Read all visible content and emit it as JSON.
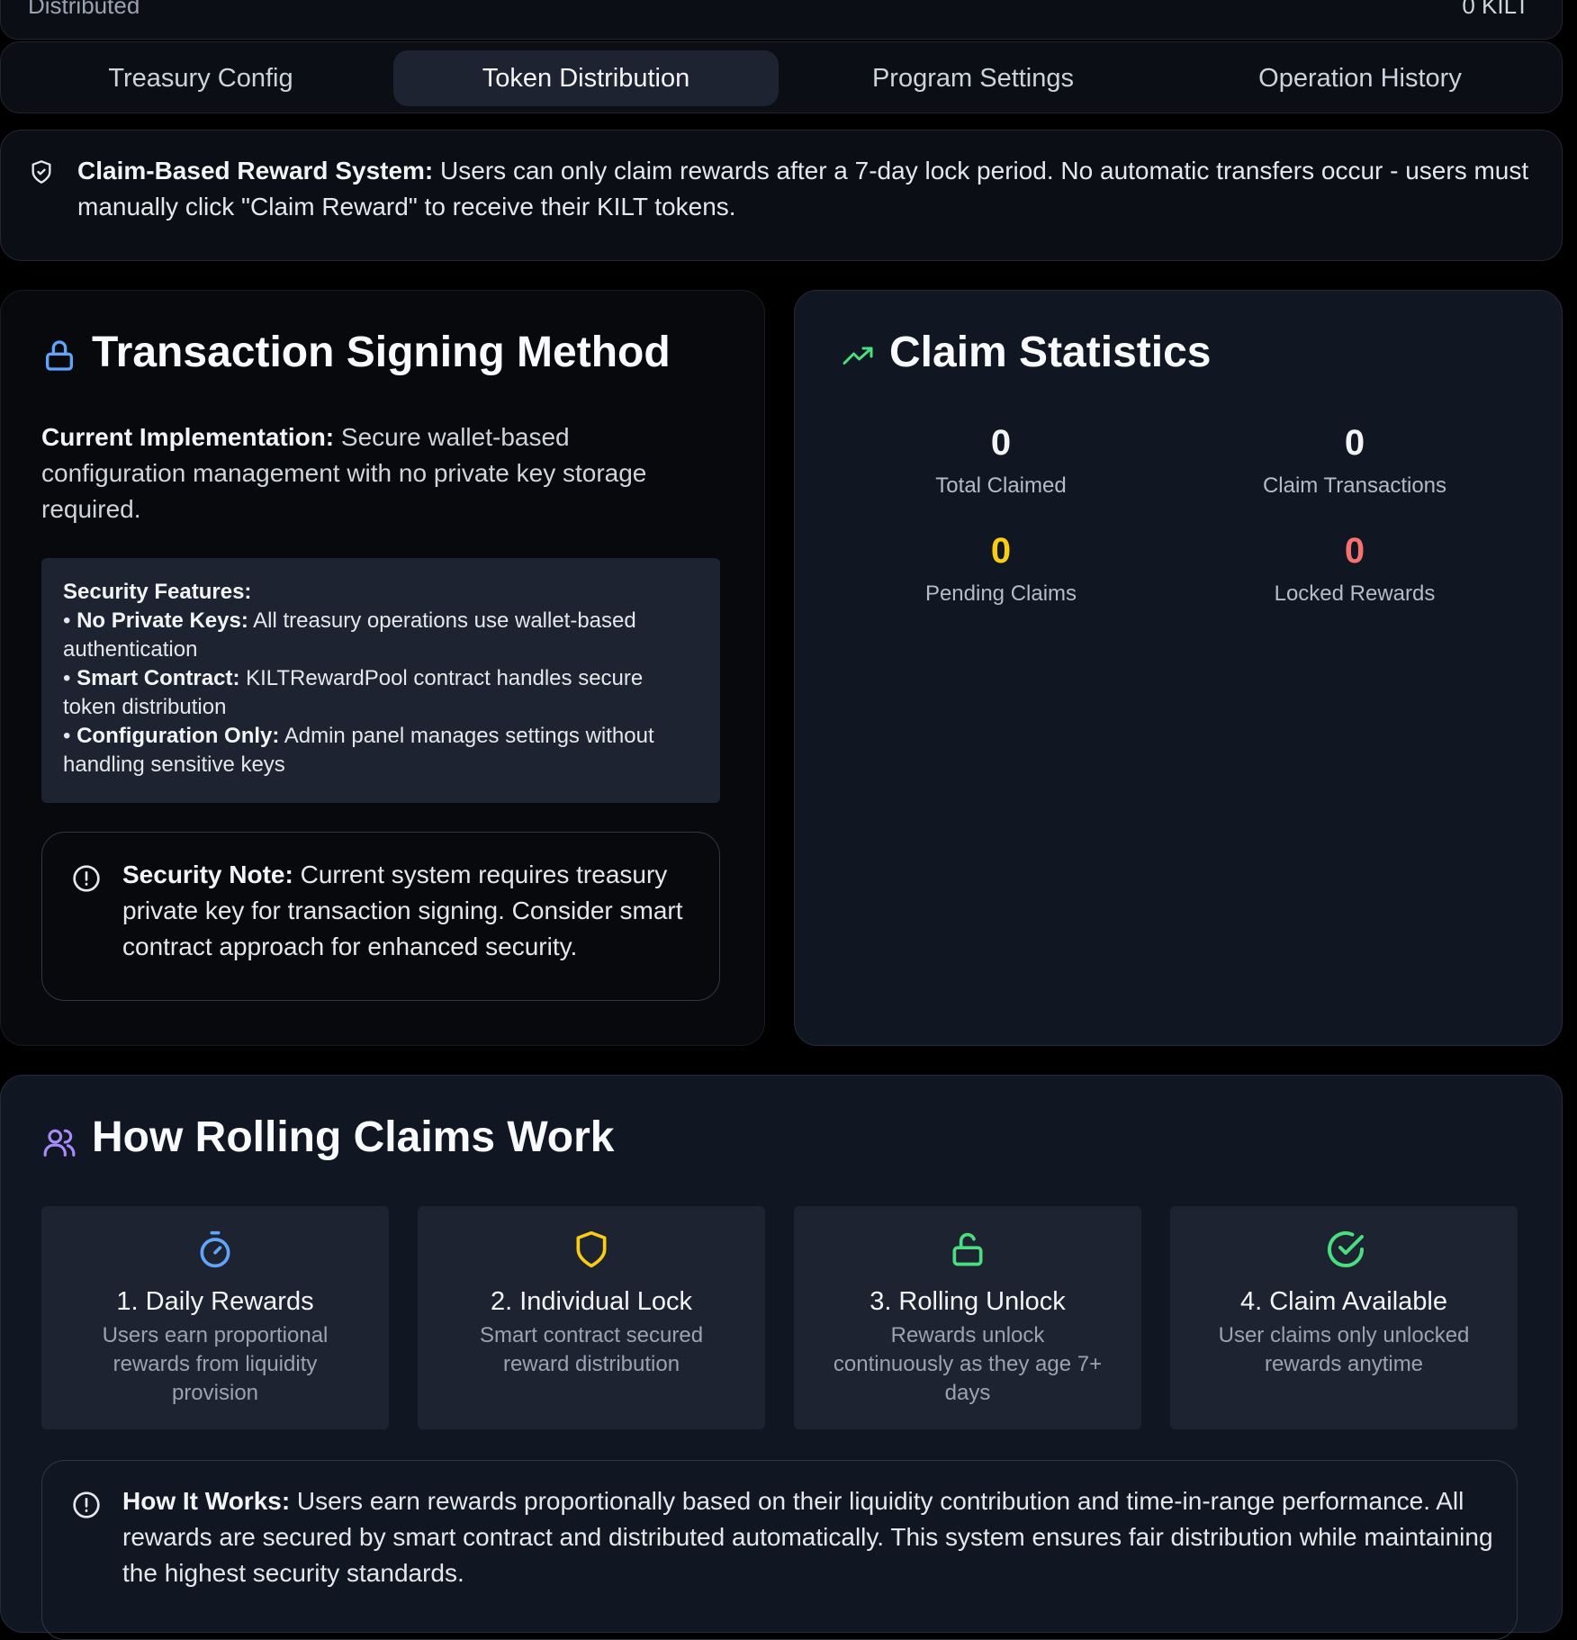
{
  "topbar": {
    "left_label": "Distributed",
    "right_value": "0 KILT"
  },
  "tabs": [
    {
      "label": "Treasury Config",
      "active": false
    },
    {
      "label": "Token Distribution",
      "active": true
    },
    {
      "label": "Program Settings",
      "active": false
    },
    {
      "label": "Operation History",
      "active": false
    }
  ],
  "banner": {
    "bold": "Claim-Based Reward System:",
    "text": " Users can only claim rewards after a 7-day lock period. No automatic transfers occur - users must manually click \"Claim Reward\" to receive their KILT tokens."
  },
  "signing": {
    "title": "Transaction Signing Method",
    "impl_bold": "Current Implementation:",
    "impl_text": " Secure wallet-based configuration management with no private key storage required.",
    "features_title": "Security Features:",
    "features": [
      {
        "bold": "No Private Keys:",
        "text": " All treasury operations use wallet-based authentication"
      },
      {
        "bold": "Smart Contract:",
        "text": " KILTRewardPool contract handles secure token distribution"
      },
      {
        "bold": "Configuration Only:",
        "text": " Admin panel manages settings without handling sensitive keys"
      }
    ],
    "note_bold": "Security Note:",
    "note_text": " Current system requires treasury private key for transaction signing. Consider smart contract approach for enhanced security."
  },
  "claims": {
    "title": "Claim Statistics",
    "stats": [
      {
        "value": "0",
        "label": "Total Claimed",
        "color": "#f3f4f6"
      },
      {
        "value": "0",
        "label": "Claim Transactions",
        "color": "#f3f4f6"
      },
      {
        "value": "0",
        "label": "Pending Claims",
        "color": "#facc15"
      },
      {
        "value": "0",
        "label": "Locked Rewards",
        "color": "#f87171"
      }
    ]
  },
  "rolling": {
    "title": "How Rolling Claims Work",
    "steps": [
      {
        "title": "1. Daily Rewards",
        "desc": "Users earn proportional rewards from liquidity provision",
        "icon": "timer-icon",
        "color": "#60a5fa"
      },
      {
        "title": "2. Individual Lock",
        "desc": "Smart contract secured reward distribution",
        "icon": "shield-icon",
        "color": "#facc15"
      },
      {
        "title": "3. Rolling Unlock",
        "desc": "Rewards unlock continuously as they age 7+ days",
        "icon": "unlock-icon",
        "color": "#4ade80"
      },
      {
        "title": "4. Claim Available",
        "desc": "User claims only unlocked rewards anytime",
        "icon": "check-circle-icon",
        "color": "#4ade80"
      }
    ],
    "how_bold": "How It Works:",
    "how_text": " Users earn rewards proportionally based on their liquidity contribution and time-in-range performance. All rewards are secured by smart contract and distributed automatically. This system ensures fair distribution while maintaining the highest security standards."
  },
  "colors": {
    "lock_icon": "#60a5fa",
    "trend_icon": "#4ade80",
    "users_icon": "#a78bfa"
  }
}
